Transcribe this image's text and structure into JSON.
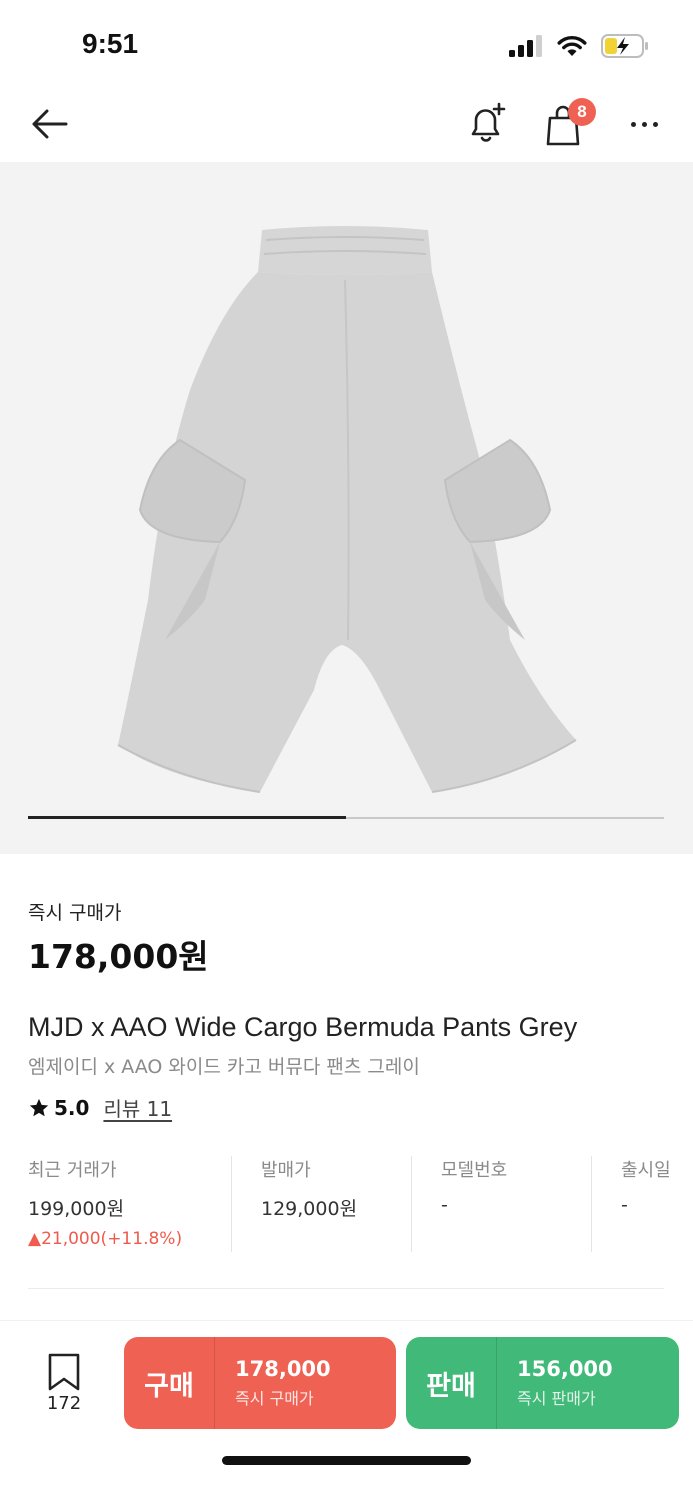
{
  "status_bar": {
    "time": "9:51"
  },
  "header": {
    "cart_badge": "8"
  },
  "gallery": {
    "progress": 0.5
  },
  "product": {
    "price_label": "즉시 구매가",
    "price": "178,000원",
    "name_en": "MJD x AAO Wide Cargo Bermuda Pants Grey",
    "name_ko": "엠제이디 x AAO 와이드 카고 버뮤다 팬츠 그레이",
    "rating": "5.0",
    "review_label": "리뷰 11"
  },
  "stats": [
    {
      "label": "최근 거래가",
      "value": "199,000원",
      "change": "▲21,000(+11.8%)"
    },
    {
      "label": "발매가",
      "value": "129,000원"
    },
    {
      "label": "모델번호",
      "value": "-"
    },
    {
      "label": "출시일",
      "value": "-"
    }
  ],
  "bottom": {
    "wish_count": "172",
    "buy": {
      "kind": "구매",
      "price": "178,000",
      "sub": "즉시 구매가"
    },
    "sell": {
      "kind": "판매",
      "price": "156,000",
      "sub": "즉시 판매가"
    }
  },
  "colors": {
    "buy": "#ef6253",
    "sell": "#41b979",
    "badge": "#ef6253",
    "price_up": "#ef5b4c"
  },
  "icons": [
    "back-arrow-icon",
    "bell-plus-icon",
    "shopping-bag-icon",
    "more-icon",
    "star-icon",
    "bookmark-icon"
  ]
}
